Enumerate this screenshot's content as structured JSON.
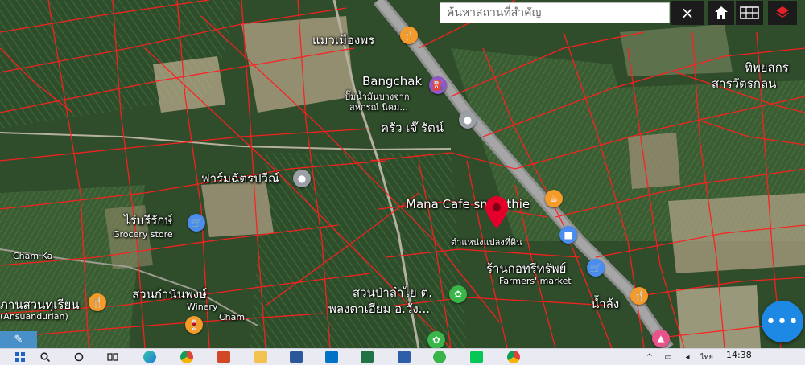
{
  "search": {
    "placeholder": "ค้นหาสถานที่สำคัญ",
    "value": ""
  },
  "toolbar": {
    "close_glyph": "×"
  },
  "map": {
    "labels": {
      "maew_muang_phon": "แมวเมืองพร",
      "bangchak": "Bangchak",
      "bangchak_th1": "ปั๊มน้ำมันบางจาก",
      "bangchak_th2": "สหกรณ์ นิคม...",
      "tipsakorn": "ทิพยสกร",
      "tipsakorn2": "สารวัตรกลน",
      "krua_jae_rat": "ครัว เจ๊ รัตน์",
      "farm_dat": "ฟาร์มฉัตรปวีณ์",
      "mana_cafe": "Mana Cafe smoothie",
      "parcel_location": "ตำแหน่งแปลงที่ดิน",
      "rai_rarak": "ไร่บรีรักษ์",
      "grocery": "Grocery store",
      "chamkat": "Cham Ka",
      "chamkat2": "Cham",
      "ran_kotri": "ร้านกอทรีทรัพย์",
      "farmers_market": "Farmers' market",
      "suan_durian": "ภานสวนทุเรียน",
      "suan_durian_en": "(Ansuandurian)",
      "suan_kamnan": "สวนกำนันพงษ์",
      "winery": "Winery",
      "suan_pa": "สวนป่าลำไย ต.",
      "phong_taeyom": "พลงตาเอียม อ.วัง...",
      "nam_lang": "น้ำล้ง"
    }
  },
  "fab": {
    "label": "•••"
  },
  "taskbar": {
    "time": "14:38",
    "lang": "ไทย",
    "apps": [
      "edge-icon",
      "chrome-icon",
      "powerpoint-icon",
      "explorer-icon",
      "word-icon",
      "outlook-icon",
      "excel-icon",
      "unknown-blue-icon",
      "green-app-icon",
      "line-icon",
      "chrome-icon"
    ]
  }
}
